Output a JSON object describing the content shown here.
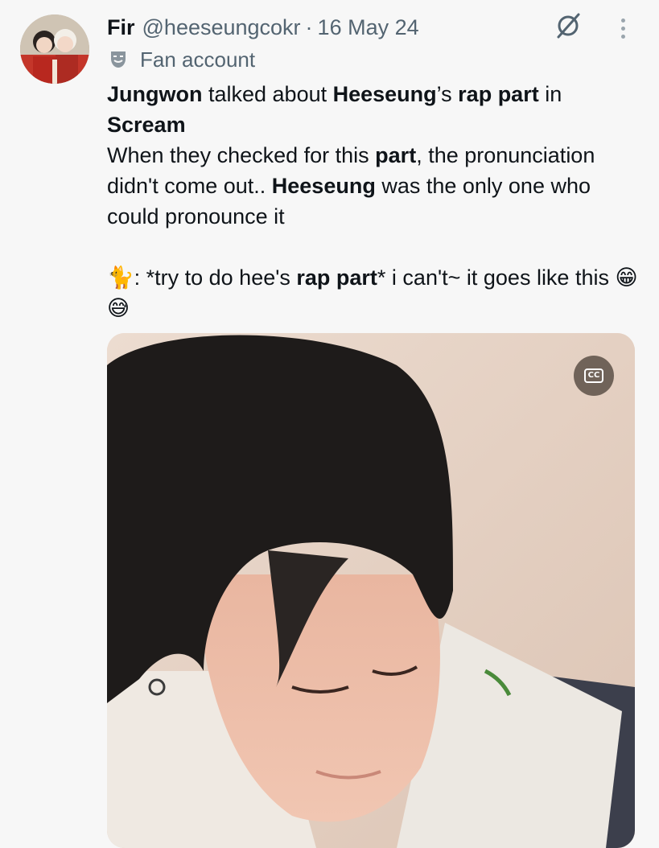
{
  "tweet": {
    "author_name": "Fir",
    "handle": "@heeseungcokr",
    "separator": "·",
    "date": "16 May 24",
    "label": "Fan account",
    "line1": {
      "t1": "Jungwon",
      "t2": " talked about ",
      "t3": "Heeseung",
      "t4": "’s ",
      "t5": "rap part",
      "t6": " in"
    },
    "line2": {
      "t1": "Scream"
    },
    "para2": {
      "t1": "When they checked for this ",
      "t2": "part",
      "t3": ", the pronunciation didn't come out.. ",
      "t4": "Heeseung",
      "t5": " was the only one who could pronounce it"
    },
    "para3": {
      "t1": "🐈",
      "t2": ": *try to do hee's ",
      "t3": "rap part",
      "t4": "* i can't~ it goes like this",
      "t5": "😁😅"
    }
  },
  "media": {
    "cc_label": "CC",
    "cc_icon": "closed-captions-icon"
  },
  "icons": {
    "grok": "grok-icon",
    "more": "more-vertical-icon",
    "label": "theater-mask-icon"
  },
  "colors": {
    "text": "#0f1419",
    "secondary": "#536471",
    "background": "#f7f7f7"
  }
}
